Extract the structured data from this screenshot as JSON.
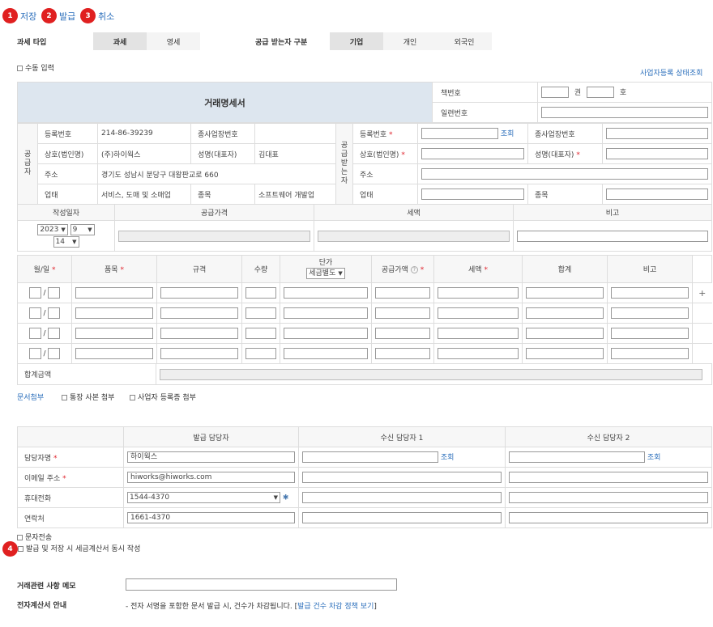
{
  "toolbar": {
    "save": "저장",
    "issue": "발급",
    "cancel": "취소"
  },
  "badges": [
    "1",
    "2",
    "3",
    "4"
  ],
  "tax_type": {
    "label": "과세 타입",
    "options": [
      "과세",
      "영세"
    ],
    "selected": "과세"
  },
  "receiver_type": {
    "label": "공급 받는자 구분",
    "options": [
      "기업",
      "개인",
      "외국인"
    ],
    "selected": "기업"
  },
  "manual_input": "수동 입력",
  "biz_status_link": "사업자등록 상태조회",
  "doc_title": "거래명세서",
  "book_no": {
    "label": "책번호",
    "vol": "권",
    "no": "호"
  },
  "serial_no": {
    "label": "일련번호"
  },
  "supplier": {
    "side_label": "공급자",
    "reg_no_label": "등록번호",
    "reg_no": "214-86-39239",
    "branch_label": "종사업장번호",
    "name_label": "상호(법인명)",
    "name": "(주)하이웍스",
    "rep_label": "성명(대표자)",
    "rep": "김대표",
    "addr_label": "주소",
    "addr": "경기도 성남시 분당구 대왕판교로 660",
    "biz_type_label": "업태",
    "biz_type": "서비스, 도매 및 소매업",
    "biz_item_label": "종목",
    "biz_item": "소프트웨어 개발업"
  },
  "receiver": {
    "side_label": "공급받는자",
    "reg_no_label": "등록번호",
    "lookup": "조회",
    "branch_label": "종사업장번호",
    "name_label": "상호(법인명)",
    "rep_label": "성명(대표자)",
    "addr_label": "주소",
    "biz_type_label": "업태",
    "biz_item_label": "종목"
  },
  "summary": {
    "date_label": "작성일자",
    "supply_label": "공급가격",
    "tax_label": "세액",
    "note_label": "비고",
    "year": "2023",
    "month": "9",
    "day": "14"
  },
  "items": {
    "cols": {
      "date": "월/일",
      "item": "품목",
      "spec": "규격",
      "qty": "수량",
      "unit": "단가",
      "unit_sel": "세금별도",
      "supply": "공급가액",
      "tax": "세액",
      "total": "합계",
      "note": "비고"
    },
    "plus": "+",
    "total_label": "합계금액"
  },
  "attach": {
    "label": "문서첨부",
    "bankbook": "통장 사본 첨부",
    "biz_cert": "사업자 등록증 첨부"
  },
  "managers": {
    "cols": [
      "발급 담당자",
      "수신 담당자 1",
      "수신 담당자 2"
    ],
    "name_label": "담당자명",
    "email_label": "이메일 주소",
    "mobile_label": "휴대전화",
    "phone_label": "연락처",
    "issuer": {
      "name": "하이웍스",
      "email": "hiworks@hiworks.com",
      "mobile": "1544-4370",
      "phone": "1661-4370"
    },
    "lookup": "조회"
  },
  "sms": "문자전송",
  "also_tax_invoice": "발급 및 저장 시 세금계산서 동시 작성",
  "memo_label": "거래관련 사항 메모",
  "einvoice": {
    "label": "전자계산서 안내",
    "text": "- 전자 서명을 포함한 문서 발급 시, 건수가 차감됩니다. [",
    "link": "발급 건수 차감 정책 보기",
    "close": "]"
  }
}
